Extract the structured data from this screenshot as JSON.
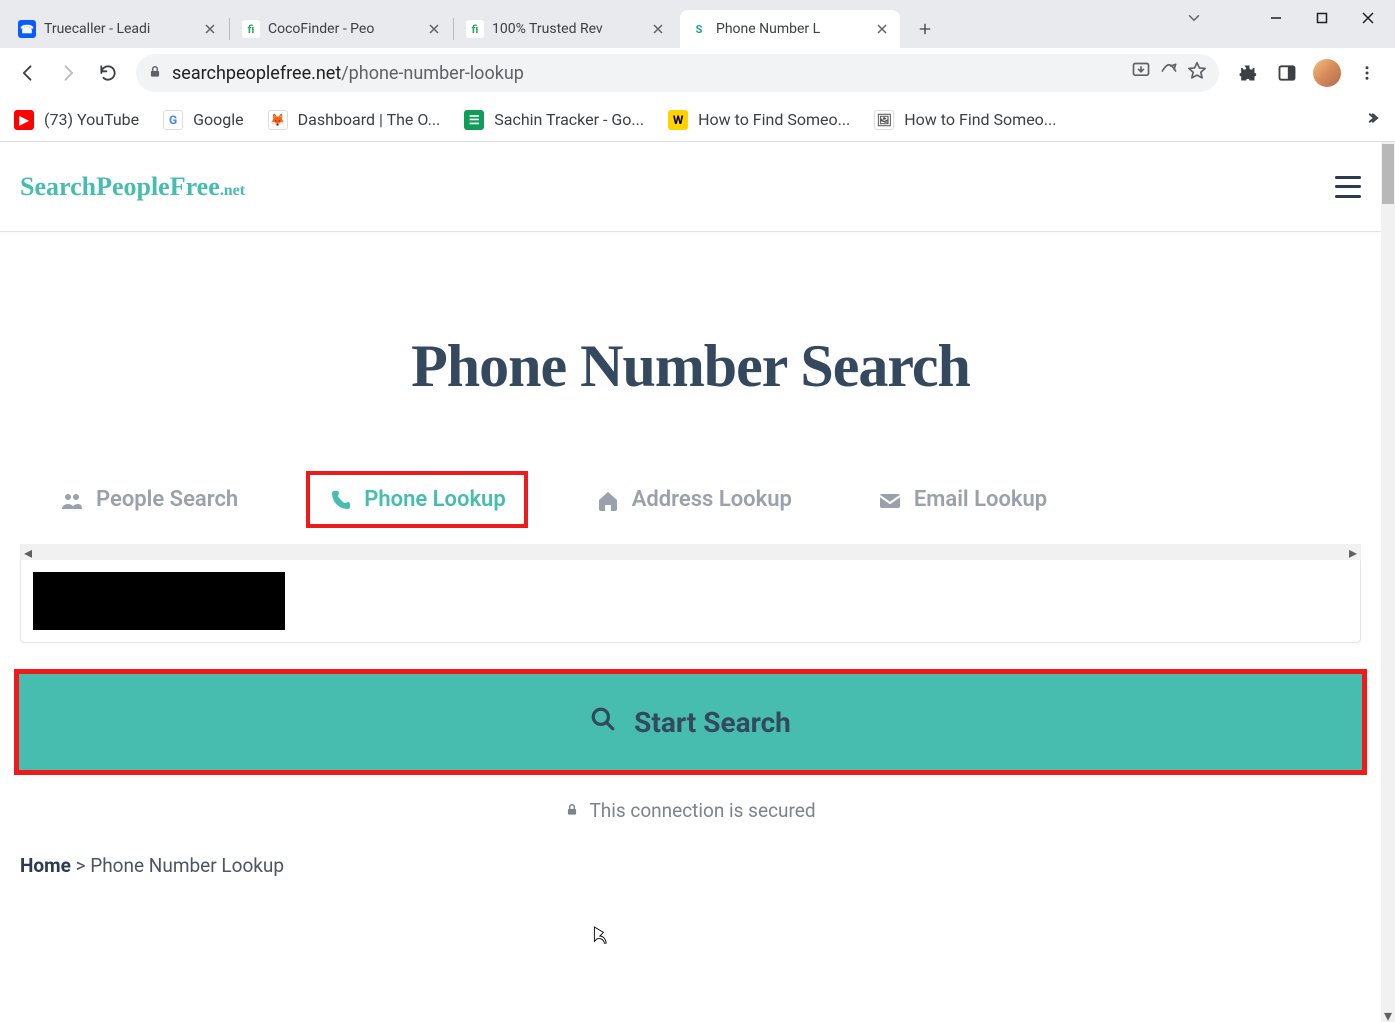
{
  "tabs": [
    {
      "title": "Truecaller - Leadi",
      "favbg": "#0a5cff",
      "favtxt": "white",
      "favchar": "☎"
    },
    {
      "title": "CocoFinder - Peo",
      "favbg": "#fff",
      "favtxt": "#2aa35a",
      "favchar": "fi"
    },
    {
      "title": "100% Trusted Rev",
      "favbg": "#fff",
      "favtxt": "#2aa35a",
      "favchar": "fi"
    },
    {
      "title": "Phone Number L",
      "favbg": "#fff",
      "favtxt": "#2a9d8f",
      "favchar": "S",
      "active": true
    }
  ],
  "url": {
    "host": "searchpeoplefree.net",
    "path": "/phone-number-lookup"
  },
  "bookmarks": [
    {
      "label": "(73) YouTube",
      "bg": "#ff0000",
      "fg": "#fff",
      "char": "▶"
    },
    {
      "label": "Google",
      "bg": "#fff",
      "fg": "#4285f4",
      "char": "G"
    },
    {
      "label": "Dashboard | The O...",
      "bg": "#fff",
      "fg": "#b07d4a",
      "char": "🦊"
    },
    {
      "label": "Sachin Tracker - Go...",
      "bg": "#0f9d58",
      "fg": "#fff",
      "char": "☰"
    },
    {
      "label": "How to Find Someo...",
      "bg": "#ffd200",
      "fg": "#000",
      "char": "W"
    },
    {
      "label": "How to Find Someo...",
      "bg": "#fff",
      "fg": "#555",
      "char": "🖼"
    }
  ],
  "site": {
    "logo_main": "SearchPeopleFree",
    "logo_sub": ".net",
    "hero": "Phone Number Search",
    "tabs": [
      {
        "label": "People Search"
      },
      {
        "label": "Phone Lookup",
        "active": true
      },
      {
        "label": "Address Lookup"
      },
      {
        "label": "Email Lookup"
      }
    ],
    "start": "Start Search",
    "secure": "This connection is secured",
    "crumb_home": "Home",
    "crumb_sep": ">",
    "crumb_current": "Phone Number Lookup"
  }
}
